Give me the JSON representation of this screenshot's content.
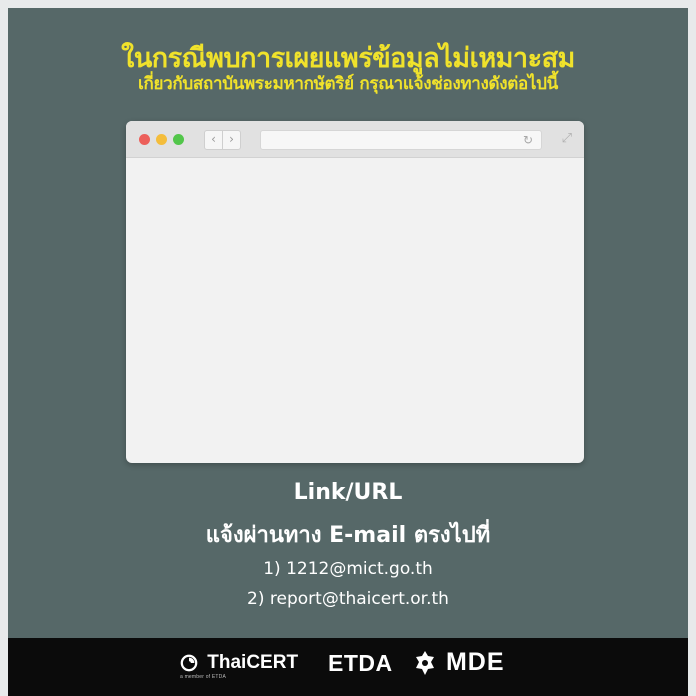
{
  "heading": {
    "line1": "ในกรณีพบการเผยแพร่ข้อมูลไม่เหมาะสม",
    "line2": "เกี่ยวกับสถาบันพระมหากษัตริย์ กรุณาแจ้งช่องทางดังต่อไปนี้"
  },
  "browser": {
    "back_glyph": "‹",
    "forward_glyph": "›",
    "reload_glyph": "↻",
    "expand_glyph": "⤢"
  },
  "report": {
    "link_label": "Link/URL",
    "instruction": "แจ้งผ่านทาง E-mail ตรงไปที่",
    "contacts": [
      "1) 1212@mict.go.th",
      "2) report@thaicert.or.th"
    ]
  },
  "footer": {
    "logos": [
      "ThaiCERT",
      "ETDA",
      "MDE"
    ],
    "thaicert_sub": "a member of ETDA"
  },
  "colors": {
    "background": "#566868",
    "heading": "#f0e22b",
    "footer": "#0b0b0b"
  }
}
